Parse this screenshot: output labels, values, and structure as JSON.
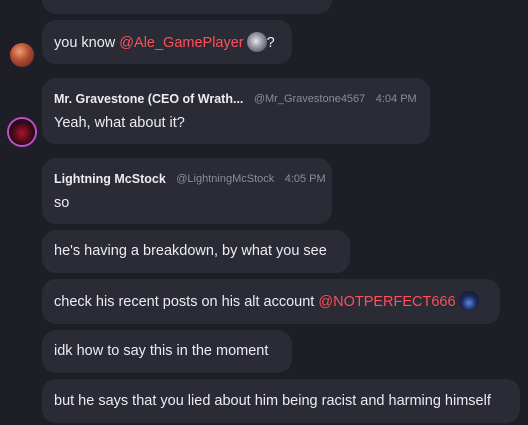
{
  "messages": [
    {
      "text_before": "you know ",
      "mention": "@Ale_GamePlayer",
      "text_after": "?"
    },
    {
      "author": "Mr. Gravestone (CEO of Wrath...",
      "handle": "@Mr_Gravestone4567",
      "time": "4:04 PM",
      "text": "Yeah, what about it?"
    },
    {
      "author": "Lightning McStock",
      "handle": "@LightningMcStock",
      "time": "4:05 PM",
      "text": "so"
    },
    {
      "text": "he's having a breakdown, by what you see"
    },
    {
      "text_before": "check his recent posts on his alt account ",
      "mention": "@NOTPERFECT666"
    },
    {
      "text": "idk how to say this in the moment"
    },
    {
      "text": "but he says that you lied about him being racist and harming himself"
    }
  ],
  "colors": {
    "background": "#1e1e26",
    "bubble": "#2b2b35",
    "mention": "#ff4f5b",
    "meta": "#8c8c99"
  }
}
